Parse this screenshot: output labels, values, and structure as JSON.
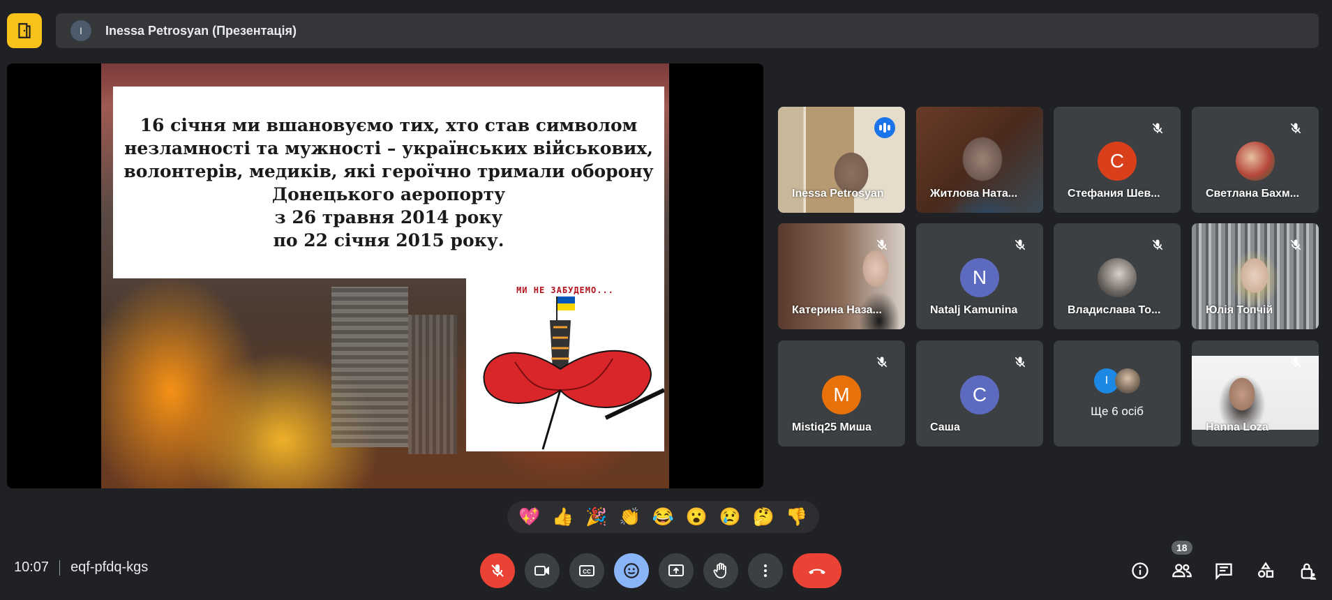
{
  "topbar": {
    "presenter_avatar_letter": "I",
    "presenter_label": "Inessa Petrosyan (Презентація)"
  },
  "slide": {
    "lines": [
      "16 січня ми вшановуємо тих, хто став символом",
      "незламності та мужності – українських військових,",
      "волонтерів, медиків, які героїчно тримали оборону",
      "Донецького аеропорту",
      "з 26 травня 2014 року",
      "по 22 січня 2015 року."
    ],
    "poster_caption": "МИ НЕ ЗАБУДЕМО..."
  },
  "participants": [
    {
      "name": "Inessa Petrosyan",
      "type": "video",
      "speaking": true
    },
    {
      "name": "Житлова Ната...",
      "type": "video"
    },
    {
      "name": "Стефания Шев...",
      "type": "avatar",
      "letter": "С",
      "color": "#d93f1b"
    },
    {
      "name": "Светлана Бахм...",
      "type": "photo"
    },
    {
      "name": "Катерина Наза...",
      "type": "video"
    },
    {
      "name": "Natalj Kamunina",
      "type": "avatar",
      "letter": "N",
      "color": "#5c6bc0"
    },
    {
      "name": "Владислава То...",
      "type": "photo"
    },
    {
      "name": "Юлія Топчій",
      "type": "video"
    },
    {
      "name": "Mistiq25 Миша",
      "type": "avatar",
      "letter": "M",
      "color": "#e8710a"
    },
    {
      "name": "Саша",
      "type": "avatar",
      "letter": "С",
      "color": "#5c6bc0"
    },
    {
      "name": "Ще 6 осіб",
      "type": "more",
      "letter": "I"
    },
    {
      "name": "Hanna Loza",
      "type": "video"
    }
  ],
  "reactions": [
    "💖",
    "👍",
    "🎉",
    "👏",
    "😂",
    "😮",
    "😢",
    "🤔",
    "👎"
  ],
  "bottombar": {
    "time": "10:07",
    "meeting_code": "eqf-pfdq-kgs",
    "people_count": "18"
  },
  "colors": {
    "background": "#202124",
    "accent": "#8ab4f8",
    "danger": "#ea4335",
    "logo": "#f9c21b"
  }
}
